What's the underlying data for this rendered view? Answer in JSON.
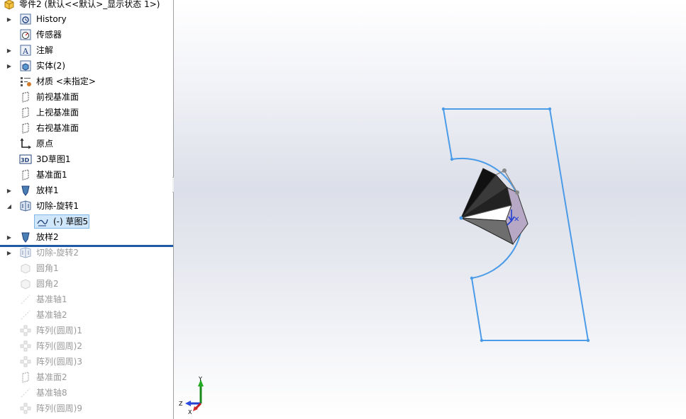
{
  "root": {
    "label": "零件2 (默认<<默认>_显示状态 1>)"
  },
  "tree": [
    {
      "label": "History",
      "icon": "history-icon",
      "expander": "collapsed",
      "dim": false,
      "indent": 0
    },
    {
      "label": "传感器",
      "icon": "sensor-icon",
      "expander": "none",
      "dim": false,
      "indent": 0
    },
    {
      "label": "注解",
      "icon": "annotation-icon",
      "expander": "collapsed",
      "dim": false,
      "indent": 0
    },
    {
      "label": "实体(2)",
      "icon": "solid-bodies-icon",
      "expander": "collapsed",
      "dim": false,
      "indent": 0
    },
    {
      "label": "材质 <未指定>",
      "icon": "material-icon",
      "expander": "none",
      "dim": false,
      "indent": 0
    },
    {
      "label": "前视基准面",
      "icon": "plane-icon",
      "expander": "none",
      "dim": false,
      "indent": 0
    },
    {
      "label": "上视基准面",
      "icon": "plane-icon",
      "expander": "none",
      "dim": false,
      "indent": 0
    },
    {
      "label": "右视基准面",
      "icon": "plane-icon",
      "expander": "none",
      "dim": false,
      "indent": 0
    },
    {
      "label": "原点",
      "icon": "origin-icon",
      "expander": "none",
      "dim": false,
      "indent": 0
    },
    {
      "label": "3D草图1",
      "icon": "3d-sketch-icon",
      "expander": "none",
      "dim": false,
      "indent": 0
    },
    {
      "label": "基准面1",
      "icon": "plane-icon",
      "expander": "none",
      "dim": false,
      "indent": 0
    },
    {
      "label": "放样1",
      "icon": "loft-icon",
      "expander": "collapsed",
      "dim": false,
      "indent": 0
    },
    {
      "label": "切除-旋转1",
      "icon": "cut-revolve-icon",
      "expander": "expanded",
      "dim": false,
      "indent": 0
    },
    {
      "label": "(-) 草图5",
      "icon": "sketch-icon",
      "expander": "none",
      "dim": false,
      "indent": 1,
      "selected": true
    },
    {
      "label": "放样2",
      "icon": "loft-icon",
      "expander": "collapsed",
      "dim": false,
      "indent": 0
    },
    {
      "label": "切除-旋转2",
      "icon": "cut-revolve-icon",
      "expander": "collapsed",
      "dim": true,
      "indent": 0
    },
    {
      "label": "圆角1",
      "icon": "fillet-icon",
      "expander": "none",
      "dim": true,
      "indent": 0
    },
    {
      "label": "圆角2",
      "icon": "fillet-icon",
      "expander": "none",
      "dim": true,
      "indent": 0
    },
    {
      "label": "基准轴1",
      "icon": "axis-icon",
      "expander": "none",
      "dim": true,
      "indent": 0
    },
    {
      "label": "基准轴2",
      "icon": "axis-icon",
      "expander": "none",
      "dim": true,
      "indent": 0
    },
    {
      "label": "阵列(圆周)1",
      "icon": "circular-pattern-icon",
      "expander": "none",
      "dim": true,
      "indent": 0
    },
    {
      "label": "阵列(圆周)2",
      "icon": "circular-pattern-icon",
      "expander": "none",
      "dim": true,
      "indent": 0
    },
    {
      "label": "阵列(圆周)3",
      "icon": "circular-pattern-icon",
      "expander": "none",
      "dim": true,
      "indent": 0
    },
    {
      "label": "基准面2",
      "icon": "plane-icon",
      "expander": "none",
      "dim": true,
      "indent": 0
    },
    {
      "label": "基准轴8",
      "icon": "axis-icon",
      "expander": "none",
      "dim": true,
      "indent": 0
    },
    {
      "label": "阵列(圆周)9",
      "icon": "circular-pattern-icon",
      "expander": "none",
      "dim": true,
      "indent": 0
    }
  ],
  "triad": {
    "y": "Y",
    "z": "Z",
    "x": "X"
  },
  "colors": {
    "sketch": "#4a9be8",
    "rollback_bar": "#1f5aa6",
    "selection": "#cfe6fb"
  }
}
